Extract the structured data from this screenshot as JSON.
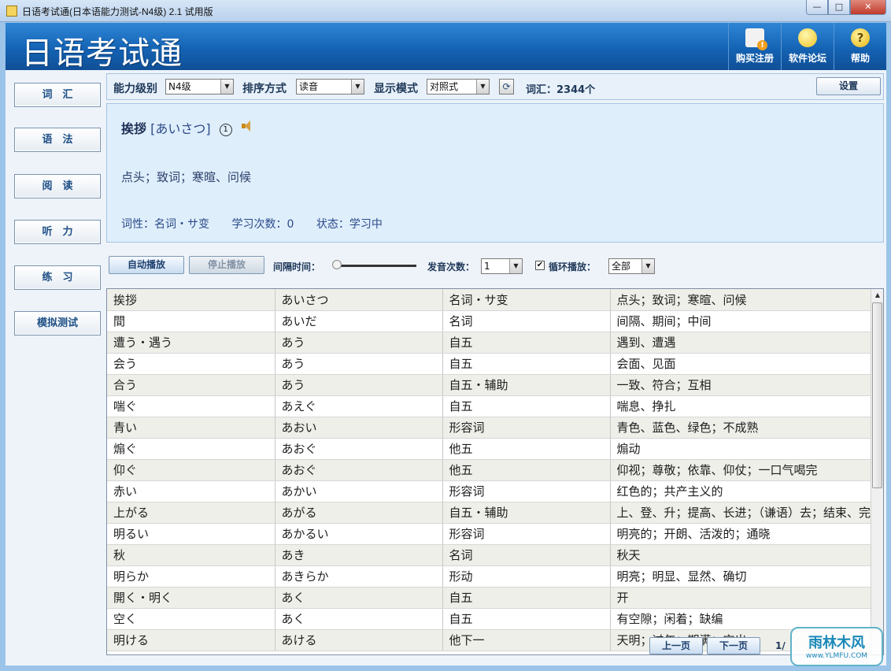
{
  "window": {
    "title": "日语考试通(日本语能力测试-N4级) 2.1 试用版",
    "min": "—",
    "max": "□",
    "close": "✕"
  },
  "header": {
    "logo": "日语考试通",
    "buttons": [
      {
        "label": "购买注册",
        "icon": "purchase-register-icon"
      },
      {
        "label": "软件论坛",
        "icon": "lightbulb-icon"
      },
      {
        "label": "帮助",
        "icon": "help-icon"
      }
    ]
  },
  "sidebar": {
    "items": [
      {
        "label": "词　汇"
      },
      {
        "label": "语　法"
      },
      {
        "label": "阅　读"
      },
      {
        "label": "听　力"
      },
      {
        "label": "练　习"
      },
      {
        "label": "模拟测试"
      }
    ]
  },
  "toolbar": {
    "level_label": "能力级别",
    "level_value": "N4级",
    "sort_label": "排序方式",
    "sort_value": "读音",
    "mode_label": "显示模式",
    "mode_value": "对照式",
    "vocab_count": "词汇：2344个",
    "settings_label": "设置"
  },
  "detail": {
    "word": "挨拶",
    "reading": "[あいさつ]",
    "accent": "1",
    "meaning": "点头；致词；寒暄、问候",
    "pos": "词性：名词・サ变",
    "study_count": "学习次数：0",
    "status": "状态：学习中"
  },
  "playback": {
    "auto_label": "自动播放",
    "stop_label": "停止播放",
    "interval_label": "间隔时间：",
    "interval_level": 0.0,
    "count_label": "发音次数：",
    "count_value": "1",
    "loop_label": "循环播放：",
    "loop_checked": true,
    "loop_value": "全部"
  },
  "table": {
    "rows": [
      [
        "挨拶",
        "あいさつ",
        "名词・サ变",
        "点头；致词；寒暄、问候"
      ],
      [
        "間",
        "あいだ",
        "名词",
        "间隔、期间；中间"
      ],
      [
        "遭う・遇う",
        "あう",
        "自五",
        "遇到、遭遇"
      ],
      [
        "会う",
        "あう",
        "自五",
        "会面、见面"
      ],
      [
        "合う",
        "あう",
        "自五・辅助",
        "一致、符合；互相"
      ],
      [
        "喘ぐ",
        "あえぐ",
        "自五",
        "喘息、挣扎"
      ],
      [
        "青い",
        "あおい",
        "形容词",
        "青色、蓝色、绿色；不成熟"
      ],
      [
        "煽ぐ",
        "あおぐ",
        "他五",
        "煽动"
      ],
      [
        "仰ぐ",
        "あおぐ",
        "他五",
        "仰视；尊敬；依靠、仰仗；一口气喝完"
      ],
      [
        "赤い",
        "あかい",
        "形容词",
        "红色的；共产主义的"
      ],
      [
        "上がる",
        "あがる",
        "自五・辅助",
        "上、登、升；提高、长进；（谦语）去；结束、完"
      ],
      [
        "明るい",
        "あかるい",
        "形容词",
        "明亮的；开朗、活泼的；通晓"
      ],
      [
        "秋",
        "あき",
        "名词",
        "秋天"
      ],
      [
        "明らか",
        "あきらか",
        "形动",
        "明亮；明显、显然、确切"
      ],
      [
        "開く・明く",
        "あく",
        "自五",
        "开"
      ],
      [
        "空く",
        "あく",
        "自五",
        "有空隙；闲着；缺编"
      ],
      [
        "明ける",
        "あける",
        "他下一",
        "天明；过年；期满；空出"
      ]
    ]
  },
  "pager": {
    "prev": "上一页",
    "next": "下一页",
    "page": "1/"
  },
  "watermark": {
    "line1": "雨林木风",
    "line2": "www.YLMFU.COM"
  }
}
